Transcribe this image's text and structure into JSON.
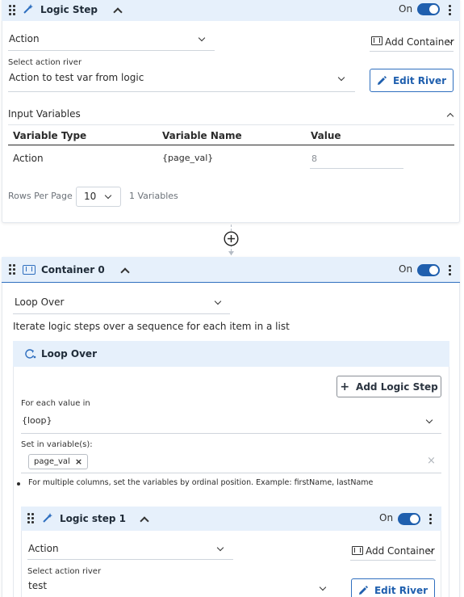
{
  "logic_step": {
    "title": "Logic Step",
    "toggle_label": "On",
    "action_select": "Action",
    "add_container_label": "Add Container",
    "river_label": "Select action river",
    "river_value": "Action to test var from logic",
    "edit_river_label": "Edit River",
    "input_vars_title": "Input Variables",
    "table": {
      "headers": [
        "Variable Type",
        "Variable Name",
        "Value"
      ],
      "rows": [
        {
          "type": "Action",
          "name": "{page_val}",
          "value": "8"
        }
      ]
    },
    "rows_per_page_label": "Rows Per Page",
    "rows_per_page_value": "10",
    "variables_count": "1 Variables"
  },
  "container": {
    "title": "Container 0",
    "toggle_label": "On",
    "loop_select": "Loop Over",
    "description": "Iterate logic steps over a sequence for each item in a list",
    "loop_title": "Loop Over",
    "add_logic_step_label": "Add Logic Step",
    "for_each_label": "For each value in",
    "for_each_value": "{loop}",
    "set_in_label": "Set in variable(s):",
    "chip_value": "page_val",
    "hint": "For multiple columns, set the variables by ordinal position. Example: firstName, lastName"
  },
  "logic_step_1": {
    "title": "Logic step 1",
    "toggle_label": "On",
    "action_select": "Action",
    "add_container_label": "Add Container",
    "river_label": "Select action river",
    "river_value": "test",
    "edit_river_label": "Edit River"
  },
  "colors": {
    "accent": "#1f5fae",
    "header_bg": "#e6f0fb"
  }
}
